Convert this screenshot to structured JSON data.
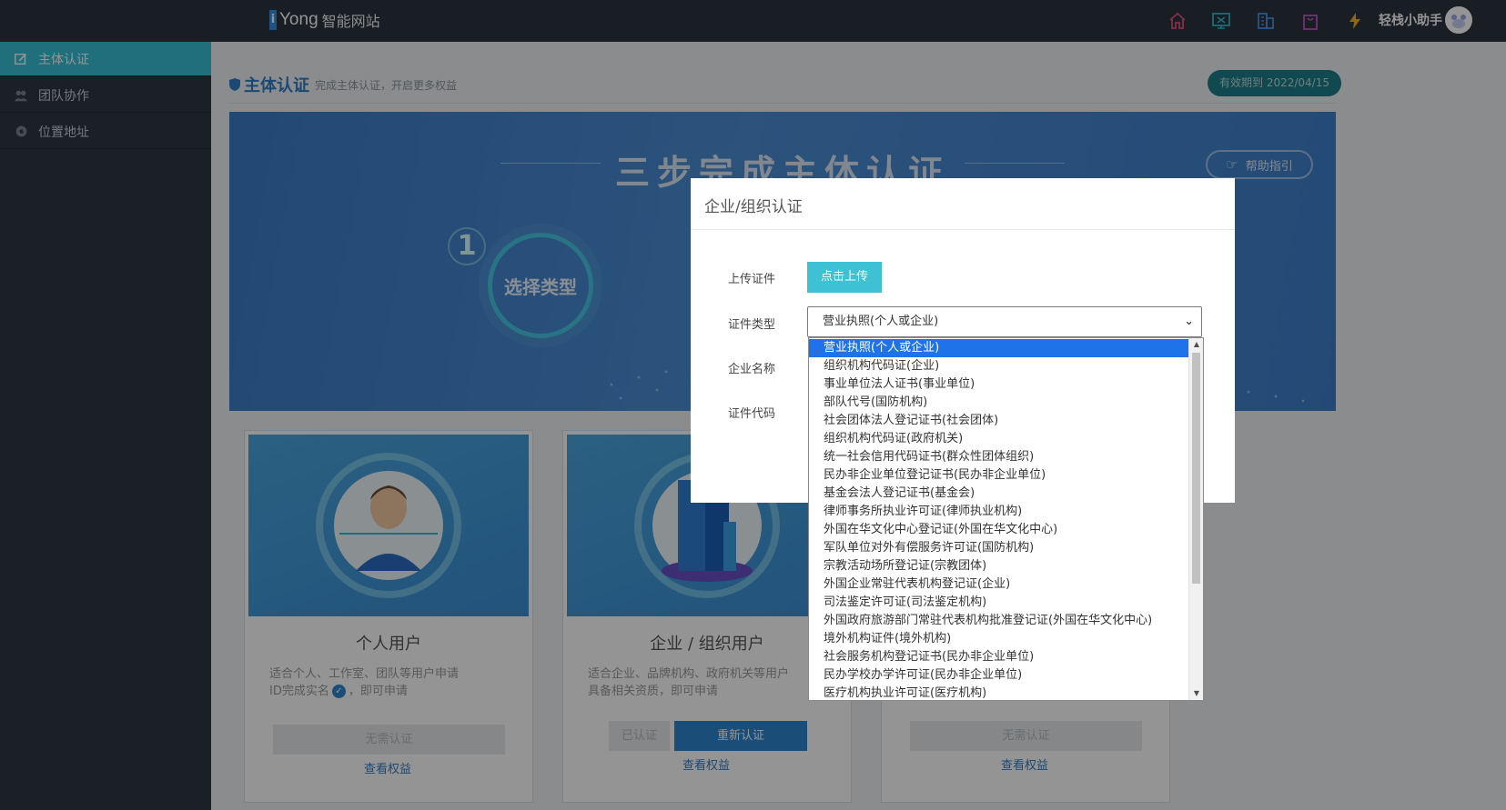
{
  "header": {
    "logo_mark": "i",
    "logo_brand": "Yong",
    "logo_name": "智能网站",
    "assistant": "轻栈小助手",
    "icons": [
      "home-icon",
      "monitor-icon",
      "building-icon",
      "bag-icon",
      "lightning-icon"
    ]
  },
  "sidebar": {
    "items": [
      {
        "label": "主体认证",
        "icon": "edit-icon",
        "active": true
      },
      {
        "label": "团队协作",
        "icon": "team-icon",
        "active": false
      },
      {
        "label": "位置地址",
        "icon": "location-icon",
        "active": false
      }
    ]
  },
  "main": {
    "title": "主体认证",
    "subtitle": "完成主体认证，开启更多权益",
    "valid_until": "有效期到 2022/04/15",
    "banner": {
      "title": "三步完成主体认证",
      "help": "帮助指引",
      "step_number": "1",
      "step_label": "选择类型"
    },
    "cards": [
      {
        "title": "个人用户",
        "desc_line1": "适合个人、工作室、团队等用户申请",
        "desc_line2": "ID完成实名",
        "desc_line2_tail": "，即可申请",
        "btn": "无需认证",
        "link": "查看权益"
      },
      {
        "title": "企业 / 组织用户",
        "desc_line1": "适合企业、品牌机构、政府机关等用户",
        "desc_line2": "具备相关资质，即可申请",
        "btn_done": "已认证",
        "btn_redo": "重新认证",
        "link": "查看权益"
      },
      {
        "btn": "无需认证",
        "link": "查看权益"
      }
    ]
  },
  "modal": {
    "title": "企业/组织认证",
    "labels": {
      "upload": "上传证件",
      "type": "证件类型",
      "name": "企业名称",
      "code": "证件代码"
    },
    "upload_button": "点击上传",
    "selected_type": "营业执照(个人或企业)",
    "options": [
      "营业执照(个人或企业)",
      "组织机构代码证(企业)",
      "事业单位法人证书(事业单位)",
      "部队代号(国防机构)",
      "社会团体法人登记证书(社会团体)",
      "组织机构代码证(政府机关)",
      "统一社会信用代码证书(群众性团体组织)",
      "民办非企业单位登记证书(民办非企业单位)",
      "基金会法人登记证书(基金会)",
      "律师事务所执业许可证(律师执业机构)",
      "外国在华文化中心登记证(外国在华文化中心)",
      "军队单位对外有偿服务许可证(国防机构)",
      "宗教活动场所登记证(宗教团体)",
      "外国企业常驻代表机构登记证(企业)",
      "司法鉴定许可证(司法鉴定机构)",
      "外国政府旅游部门常驻代表机构批准登记证(外国在华文化中心)",
      "境外机构证件(境外机构)",
      "社会服务机构登记证书(民办非企业单位)",
      "民办学校办学许可证(民办非企业单位)",
      "医疗机构执业许可证(医疗机构)"
    ]
  },
  "colors": {
    "accent": "#38c0d8",
    "primary": "#2e86cf",
    "topbar": "#2b323f",
    "sidebar": "#2f3744"
  }
}
